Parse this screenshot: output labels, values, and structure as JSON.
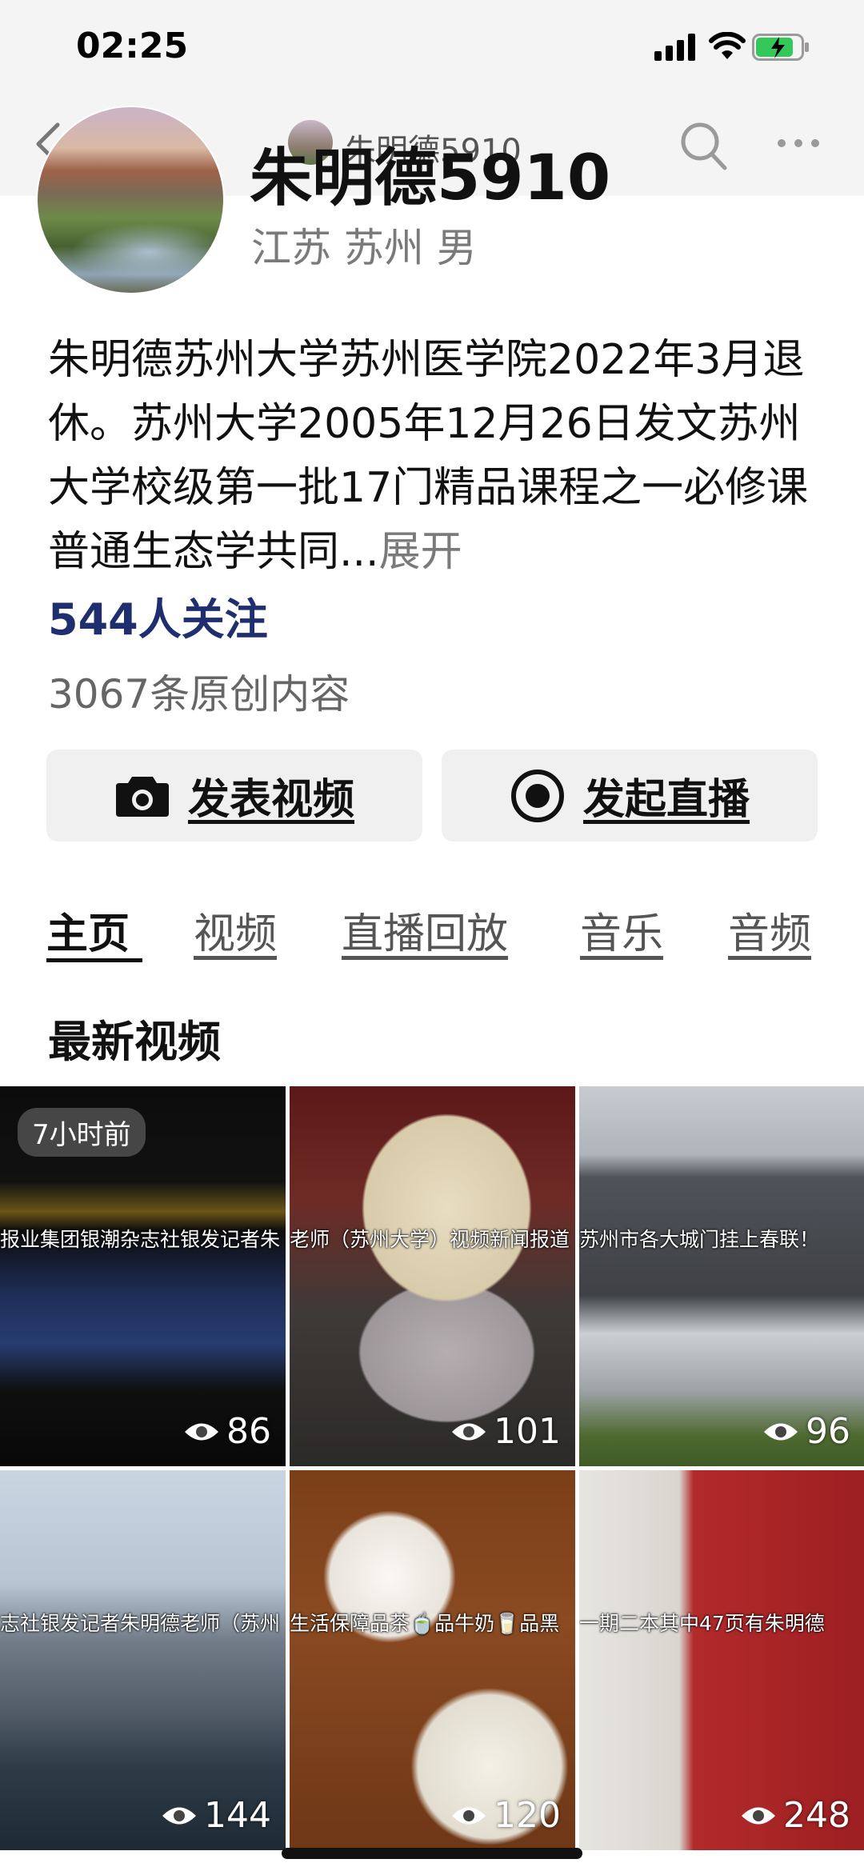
{
  "status_bar": {
    "time": "02:25"
  },
  "nav": {
    "title": "朱明德5910"
  },
  "profile": {
    "username": "朱明德5910",
    "location": "江苏 苏州 男",
    "bio": "朱明德苏州大学苏州医学院2022年3月退休。苏州大学2005年12月26日发文苏州大学校级第一批17门精品课程之一必修课普通生态学共同...",
    "bio_more": "展开",
    "followers": "544人关注",
    "works": "3067条原创内容"
  },
  "actions": {
    "post_video": "发表视频",
    "start_live": "发起直播"
  },
  "tabs": [
    "主页",
    "视频",
    "直播回放",
    "音乐",
    "音频"
  ],
  "section_title": "最新视频",
  "videos": [
    {
      "badge": "7小时前",
      "caption": "报业集团银潮杂志社银发记者朱",
      "views": "86"
    },
    {
      "caption": "老师（苏州大学）视频新闻报道",
      "views": "101"
    },
    {
      "caption": "苏州市各大城门挂上春联！",
      "views": "96"
    },
    {
      "caption": "志社银发记者朱明德老师（苏州",
      "views": "144"
    },
    {
      "caption": "生活保障品茶🍵品牛奶🥛品黑",
      "views": "120"
    },
    {
      "caption": "一期二本其中47页有朱明德",
      "views": "248"
    }
  ]
}
